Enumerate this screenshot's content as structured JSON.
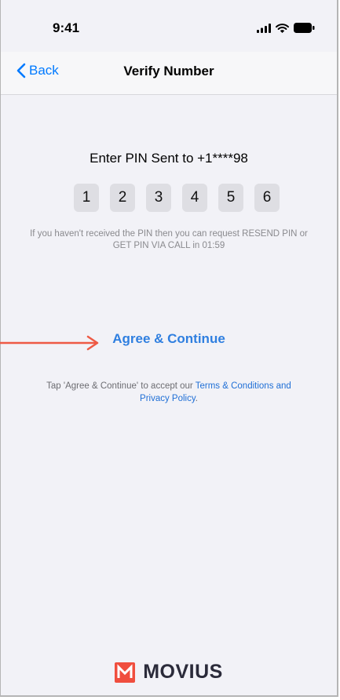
{
  "status_bar": {
    "time": "9:41"
  },
  "nav": {
    "back_label": "Back",
    "title": "Verify Number"
  },
  "main": {
    "heading": "Enter PIN Sent to +1****98",
    "pin_digits": [
      "1",
      "2",
      "3",
      "4",
      "5",
      "6"
    ],
    "pin_hint": "If you haven't received the PIN then you can request RESEND PIN or GET PIN VIA CALL in 01:59",
    "agree_label": "Agree & Continue",
    "terms_prefix": "Tap 'Agree & Continue' to accept our ",
    "terms_link": "Terms & Conditions and Privacy Policy",
    "terms_suffix": "."
  },
  "footer": {
    "brand": "MOVIUS"
  },
  "colors": {
    "accent": "#007aff",
    "link": "#2f7fe0",
    "brand_red": "#f04e3e",
    "annotation_arrow": "#ee5a45"
  },
  "icons": [
    "signal-icon",
    "wifi-icon",
    "battery-icon",
    "chevron-left-icon",
    "movius-logo-icon",
    "annotation-arrow-icon"
  ]
}
